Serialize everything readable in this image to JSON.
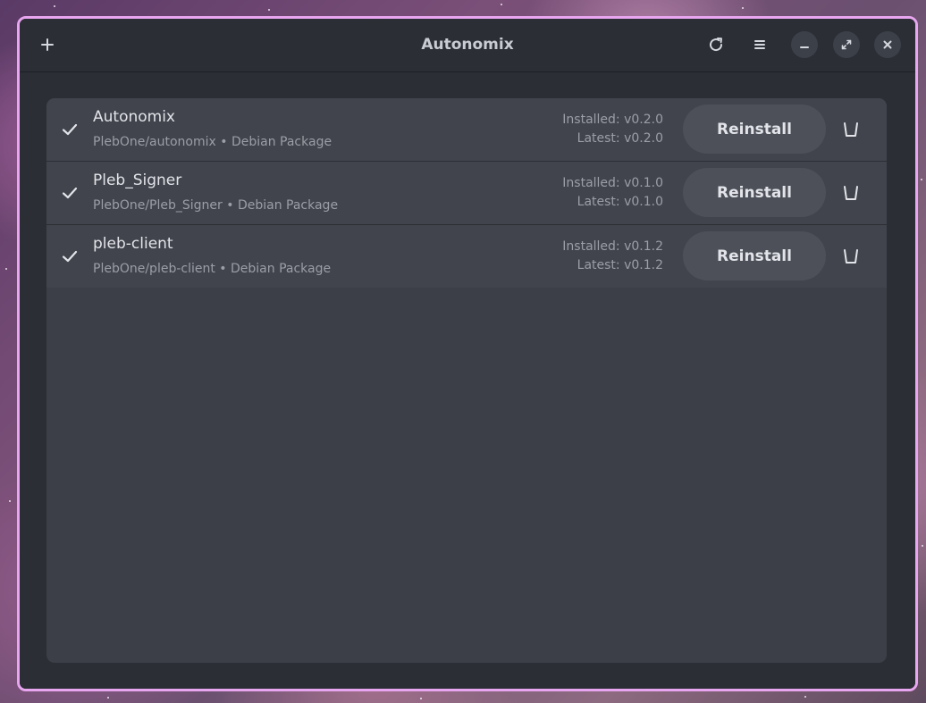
{
  "window": {
    "title": "Autonomix"
  },
  "header": {
    "add_icon": "plus-icon",
    "refresh_icon": "refresh-icon",
    "menu_icon": "hamburger-menu-icon",
    "minimize_icon": "minimize-icon",
    "maximize_icon": "maximize-icon",
    "close_icon": "close-icon"
  },
  "apps": [
    {
      "name": "Autonomix",
      "source": "PlebOne/autonomix • Debian Package",
      "installed": "Installed: v0.2.0",
      "latest": "Latest: v0.2.0",
      "action_label": "Reinstall"
    },
    {
      "name": "Pleb_Signer",
      "source": "PlebOne/Pleb_Signer • Debian Package",
      "installed": "Installed: v0.1.0",
      "latest": "Latest: v0.1.0",
      "action_label": "Reinstall"
    },
    {
      "name": "pleb-client",
      "source": "PlebOne/pleb-client • Debian Package",
      "installed": "Installed: v0.1.2",
      "latest": "Latest: v0.1.2",
      "action_label": "Reinstall"
    }
  ],
  "colors": {
    "window_border": "#e9a6f0",
    "window_bg": "#2b2e35",
    "row_bg": "#41444c",
    "button_bg": "#4d5059"
  }
}
